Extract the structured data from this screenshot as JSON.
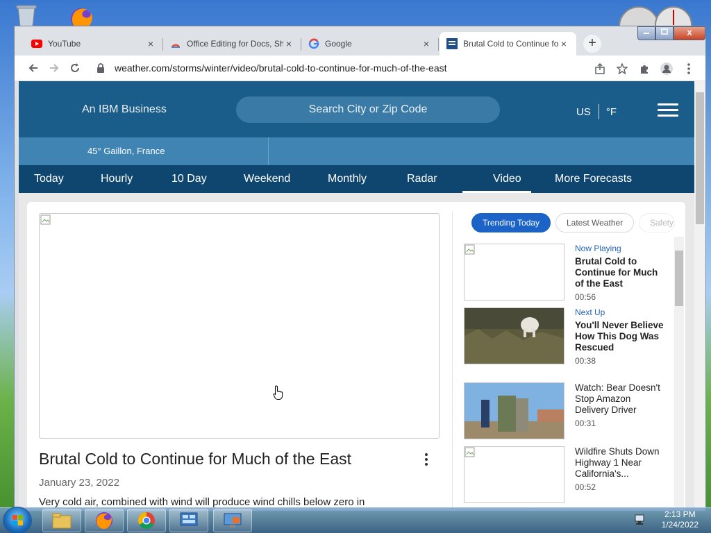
{
  "browser": {
    "tabs": [
      {
        "title": "YouTube",
        "icon": "youtube-icon",
        "active": false
      },
      {
        "title": "Office Editing for Docs, Sheets & Slides",
        "icon": "office-editing-icon",
        "active": false
      },
      {
        "title": "Google",
        "icon": "google-icon",
        "active": false
      },
      {
        "title": "Brutal Cold to Continue for Much of the East",
        "icon": "weather-channel-icon",
        "active": true
      }
    ],
    "url": "weather.com/storms/winter/video/brutal-cold-to-continue-for-much-of-the-east",
    "close_glyph": "×",
    "new_tab_glyph": "+",
    "window_controls": {
      "close": "X"
    }
  },
  "site": {
    "brand_tagline": "An IBM Business",
    "search_placeholder": "Search City or Zip Code",
    "units_region": "US",
    "units_temp": "°F",
    "location": "45° Gaillon, France",
    "nav": [
      "Today",
      "Hourly",
      "10 Day",
      "Weekend",
      "Monthly",
      "Radar",
      "Video",
      "More Forecasts"
    ],
    "nav_active": "Video"
  },
  "video": {
    "title": "Brutal Cold to Continue for Much of the East",
    "date": "January 23, 2022",
    "description": "Very cold air, combined with wind will produce wind chills below zero in"
  },
  "sidebar": {
    "filters": [
      "Trending Today",
      "Latest Weather",
      "Safety"
    ],
    "active_filter": "Trending Today",
    "items": [
      {
        "tag": "Now Playing",
        "title": "Brutal Cold to Continue for Much of the East",
        "duration": "00:56",
        "bold": true
      },
      {
        "tag": "Next Up",
        "title": "You'll Never Believe How This Dog Was Rescued",
        "duration": "00:38",
        "bold": true
      },
      {
        "tag": "",
        "title": "Watch: Bear Doesn't Stop Amazon Delivery Driver",
        "duration": "00:31",
        "bold": false
      },
      {
        "tag": "",
        "title": "Wildfire Shuts Down Highway 1 Near California's...",
        "duration": "00:52",
        "bold": false
      }
    ]
  },
  "taskbar": {
    "time": "2:13 PM",
    "date": "1/24/2022",
    "apps": [
      "file-explorer-icon",
      "firefox-icon",
      "chrome-icon",
      "control-panel-icon",
      "remote-desktop-icon"
    ]
  },
  "colors": {
    "header": "#1a5c8a",
    "nav": "#0e4670",
    "locbar": "#3f84b2",
    "accent_pill": "#1b63c7"
  }
}
